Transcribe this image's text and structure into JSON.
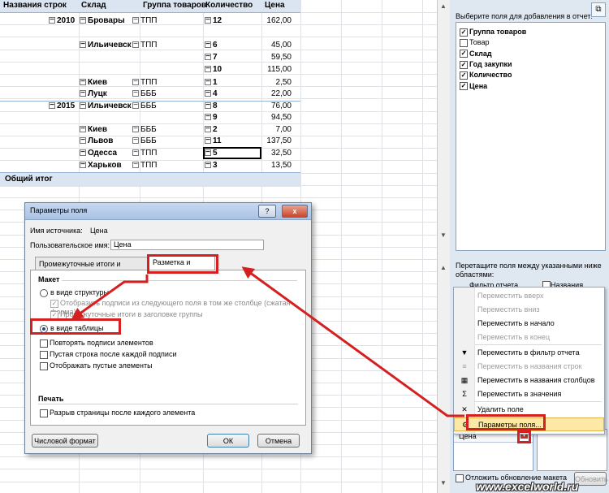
{
  "pivot": {
    "headers": [
      "Названия строк",
      "Склад",
      "Группа товаров",
      "Количество",
      "Цена"
    ],
    "rows": [
      {
        "year": "2010",
        "sklad": "Бровары",
        "group": "ТПП",
        "qty": "12",
        "price": "162,00"
      },
      {
        "year": "",
        "sklad": "Ильичевск",
        "group": "ТПП",
        "qty": "6",
        "price": "45,00"
      },
      {
        "year": "",
        "sklad": "",
        "group": "",
        "qty": "7",
        "price": "59,50"
      },
      {
        "year": "",
        "sklad": "",
        "group": "",
        "qty": "10",
        "price": "115,00"
      },
      {
        "year": "",
        "sklad": "Киев",
        "group": "ТПП",
        "qty": "1",
        "price": "2,50"
      },
      {
        "year": "",
        "sklad": "Луцк",
        "group": "БББ",
        "qty": "4",
        "price": "22,00"
      },
      {
        "year": "2015",
        "sklad": "Ильичевск",
        "group": "БББ",
        "qty": "8",
        "price": "76,00"
      },
      {
        "year": "",
        "sklad": "",
        "group": "",
        "qty": "9",
        "price": "94,50"
      },
      {
        "year": "",
        "sklad": "Киев",
        "group": "БББ",
        "qty": "2",
        "price": "7,00"
      },
      {
        "year": "",
        "sklad": "Львов",
        "group": "БББ",
        "qty": "11",
        "price": "137,50"
      },
      {
        "year": "",
        "sklad": "Одесса",
        "group": "ТПП",
        "qty": "5",
        "price": "32,50"
      },
      {
        "year": "",
        "sklad": "Харьков",
        "group": "ТПП",
        "qty": "3",
        "price": "13,50"
      }
    ],
    "total_label": "Общий итог"
  },
  "field_list": {
    "choose_label": "Выберите поля для добавления в отчет:",
    "fields": [
      {
        "label": "Группа товаров",
        "checked": true
      },
      {
        "label": "Товар",
        "checked": false
      },
      {
        "label": "Склад",
        "checked": true
      },
      {
        "label": "Год закупки",
        "checked": true
      },
      {
        "label": "Количество",
        "checked": true
      },
      {
        "label": "Цена",
        "checked": true
      }
    ],
    "drag_label": "Перетащите поля между указанными ниже областями:",
    "filter_area": "Фильтр отчета",
    "columns_area": "Названия столбцов",
    "value_field": "Цена",
    "defer_label": "Отложить обновление макета",
    "update_button": "Обновить"
  },
  "context_menu": {
    "items": [
      {
        "label": "Переместить вверх",
        "disabled": true,
        "icon": ""
      },
      {
        "label": "Переместить вниз",
        "disabled": true,
        "icon": ""
      },
      {
        "label": "Переместить в начало",
        "disabled": false,
        "icon": ""
      },
      {
        "label": "Переместить в конец",
        "disabled": true,
        "icon": ""
      },
      {
        "label": "Переместить в фильтр отчета",
        "disabled": false,
        "icon": "filter-icon"
      },
      {
        "label": "Переместить в названия строк",
        "disabled": true,
        "icon": "rows-icon"
      },
      {
        "label": "Переместить в названия столбцов",
        "disabled": false,
        "icon": "columns-icon"
      },
      {
        "label": "Переместить в значения",
        "disabled": false,
        "icon": "sigma-icon"
      },
      {
        "label": "Удалить поле",
        "disabled": false,
        "icon": "delete-icon"
      },
      {
        "label": "Параметры поля...",
        "disabled": false,
        "icon": "settings-icon"
      }
    ]
  },
  "dialog": {
    "title": "Параметры поля",
    "help_btn": "?",
    "close_btn": "x",
    "source_label": "Имя источника:",
    "source_value": "Цена",
    "custom_label": "Пользовательское имя:",
    "custom_value": "Цена",
    "tab1": "Промежуточные итоги и фильтры",
    "tab2": "Разметка и печать",
    "layout_heading": "Макет",
    "opt_outline": "в виде структуры",
    "opt_outline_sub1": "Отобразить подписи из следующего поля в том же столбце (сжатая форма)",
    "opt_outline_sub2": "Промежуточные итоги в заголовке группы",
    "opt_table": "в виде таблицы",
    "chk_repeat": "Повторять подписи элементов",
    "chk_blank": "Пустая строка после каждой подписи",
    "chk_empty": "Отображать пустые элементы",
    "print_heading": "Печать",
    "chk_pagebreak": "Разрыв страницы после каждого элемента",
    "number_format_btn": "Числовой формат",
    "ok_btn": "ОК",
    "cancel_btn": "Отмена"
  },
  "watermark": "www.excelworld.ru",
  "colors": {
    "accent": "#d42020",
    "header_band": "#dbe5f1",
    "pane_bg": "#dfe7f1",
    "menu_highlight": "#fde8a6"
  }
}
